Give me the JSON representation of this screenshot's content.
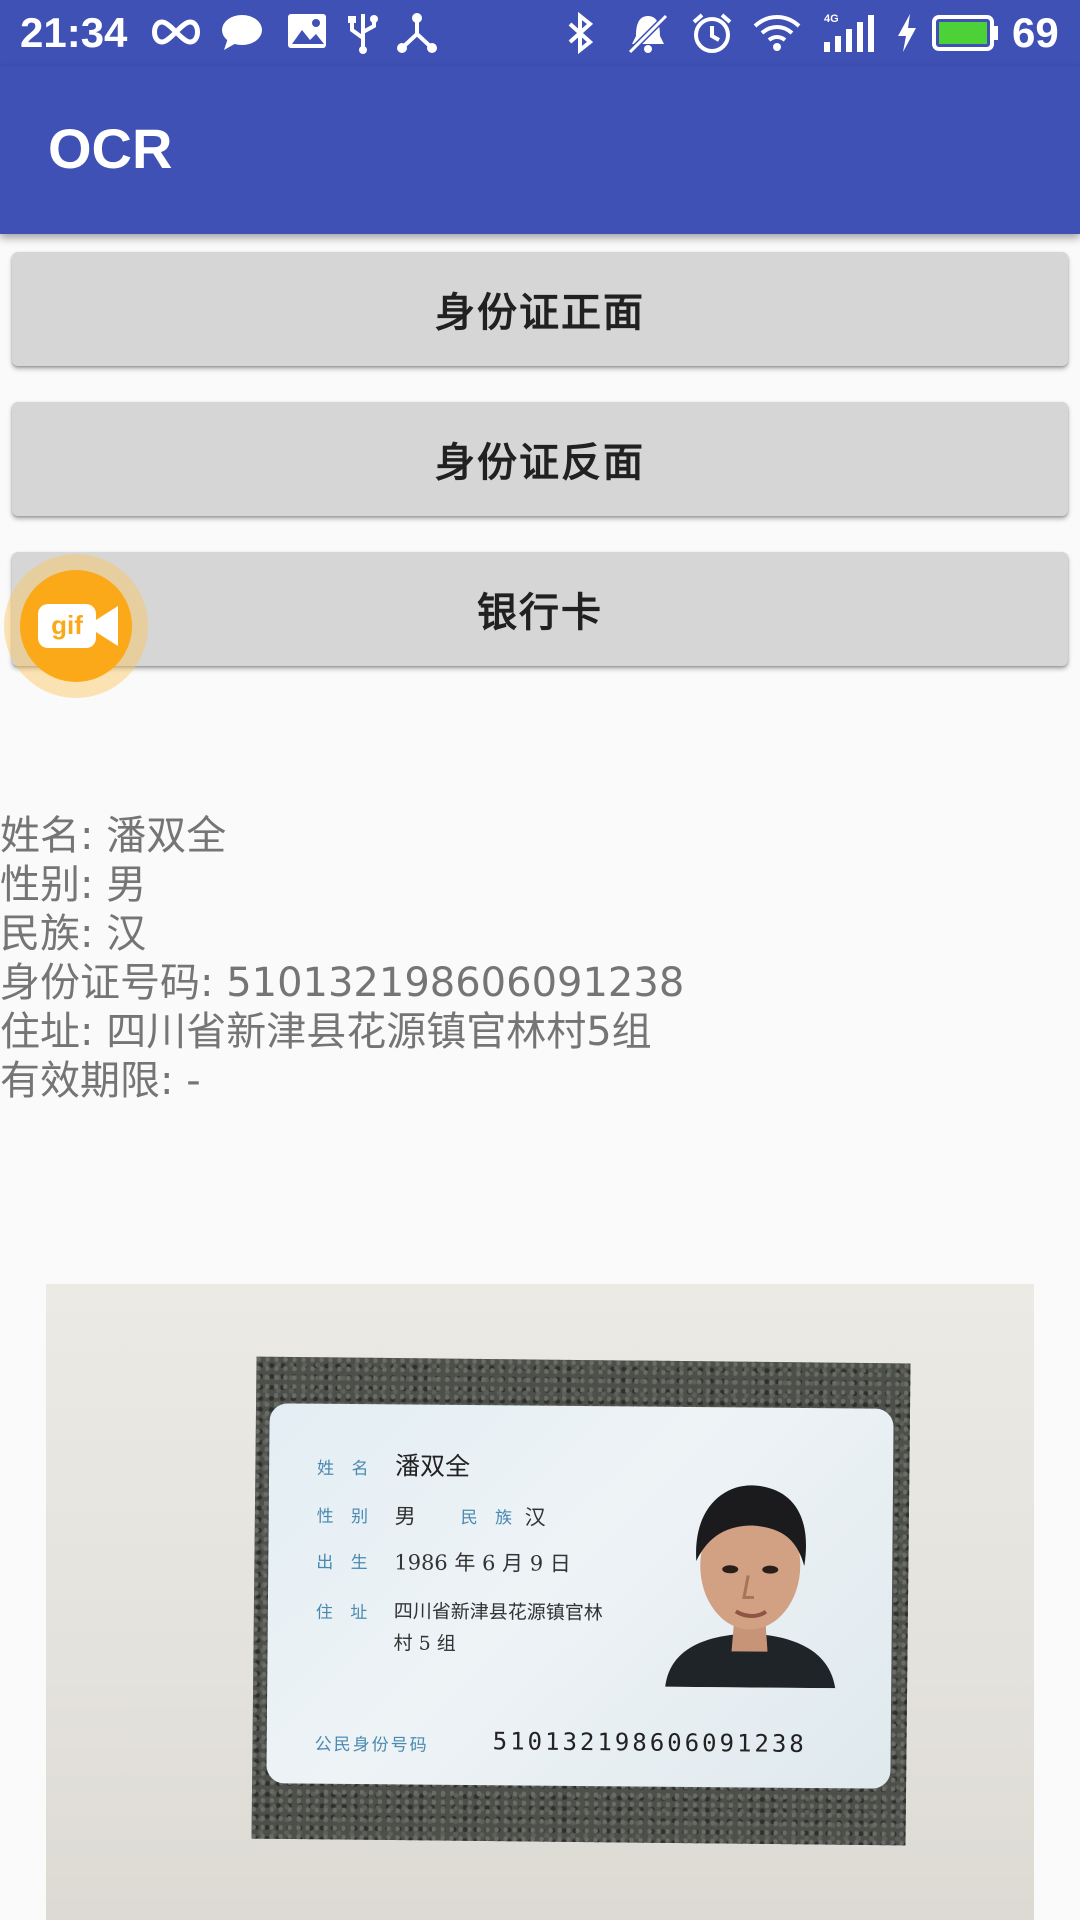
{
  "status_bar": {
    "time": "21:34",
    "battery_level": "69",
    "icons": [
      "infinity-icon",
      "chat-bubble-icon",
      "photo-icon",
      "usb-icon",
      "share-icon",
      "bluetooth-icon",
      "mute-icon",
      "alarm-icon",
      "wifi-icon",
      "signal-4g-icon",
      "charging-icon",
      "battery-icon"
    ]
  },
  "app_bar": {
    "title": "OCR"
  },
  "buttons": {
    "id_front": "身份证正面",
    "id_back": "身份证反面",
    "bank_card": "银行卡"
  },
  "gif_bubble": {
    "label": "gif"
  },
  "result": {
    "name": "姓名: 潘双全",
    "gender": "性别: 男",
    "ethnicity": "民族: 汉",
    "id_number": "身份证号码: 510132198606091238",
    "address": "住址: 四川省新津县花源镇官林村5组",
    "validity": "有效期限: -"
  },
  "id_card_photo": {
    "name_label": "姓 名",
    "name_value": "潘双全",
    "gender_label": "性 别",
    "gender_value": "男",
    "ethnicity_label": "民 族",
    "ethnicity_value": "汉",
    "birth_label": "出 生",
    "birth_value": "1986 年 6 月 9 日",
    "address_label": "住 址",
    "address_line1": "四川省新津县花源镇官林",
    "address_line2": "村 5 组",
    "id_label": "公民身份号码",
    "id_value": "510132198606091238"
  },
  "colors": {
    "primary": "#3f51b5",
    "button_bg": "#d6d6d6",
    "result_text": "#757575",
    "gif_orange": "#fba919"
  }
}
